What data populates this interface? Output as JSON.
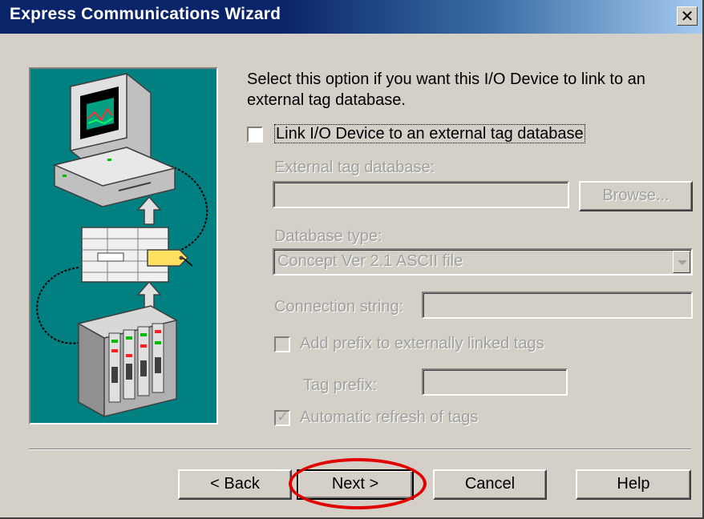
{
  "window": {
    "title": "Express Communications Wizard",
    "close_symbol": "✕"
  },
  "content": {
    "description": "Select this option if you want this I/O Device to link to an external tag database.",
    "link_checkbox_label": "Link I/O Device to an external tag database",
    "link_checked": false,
    "external_db_label": "External tag database:",
    "external_db_value": "",
    "browse_label": "Browse...",
    "db_type_label": "Database type:",
    "db_type_value": "Concept Ver 2.1 ASCII file",
    "connection_label": "Connection string:",
    "connection_value": "",
    "add_prefix_label": "Add prefix to externally linked tags",
    "add_prefix_checked": false,
    "tag_prefix_label": "Tag prefix:",
    "tag_prefix_value": "",
    "auto_refresh_label": "Automatic refresh of tags",
    "auto_refresh_checked": true,
    "check_symbol": "✓"
  },
  "buttons": {
    "back": "< Back",
    "next": "Next >",
    "cancel": "Cancel",
    "help": "Help"
  },
  "colors": {
    "title_bar": "#0a246a",
    "illustration_bg": "#008080",
    "highlight": "#e00000"
  },
  "icons": [
    "close-icon",
    "computer-icon",
    "tag-database-icon",
    "io-device-icon",
    "arrow-up-icon",
    "dropdown-arrow-icon",
    "checkmark-icon"
  ]
}
